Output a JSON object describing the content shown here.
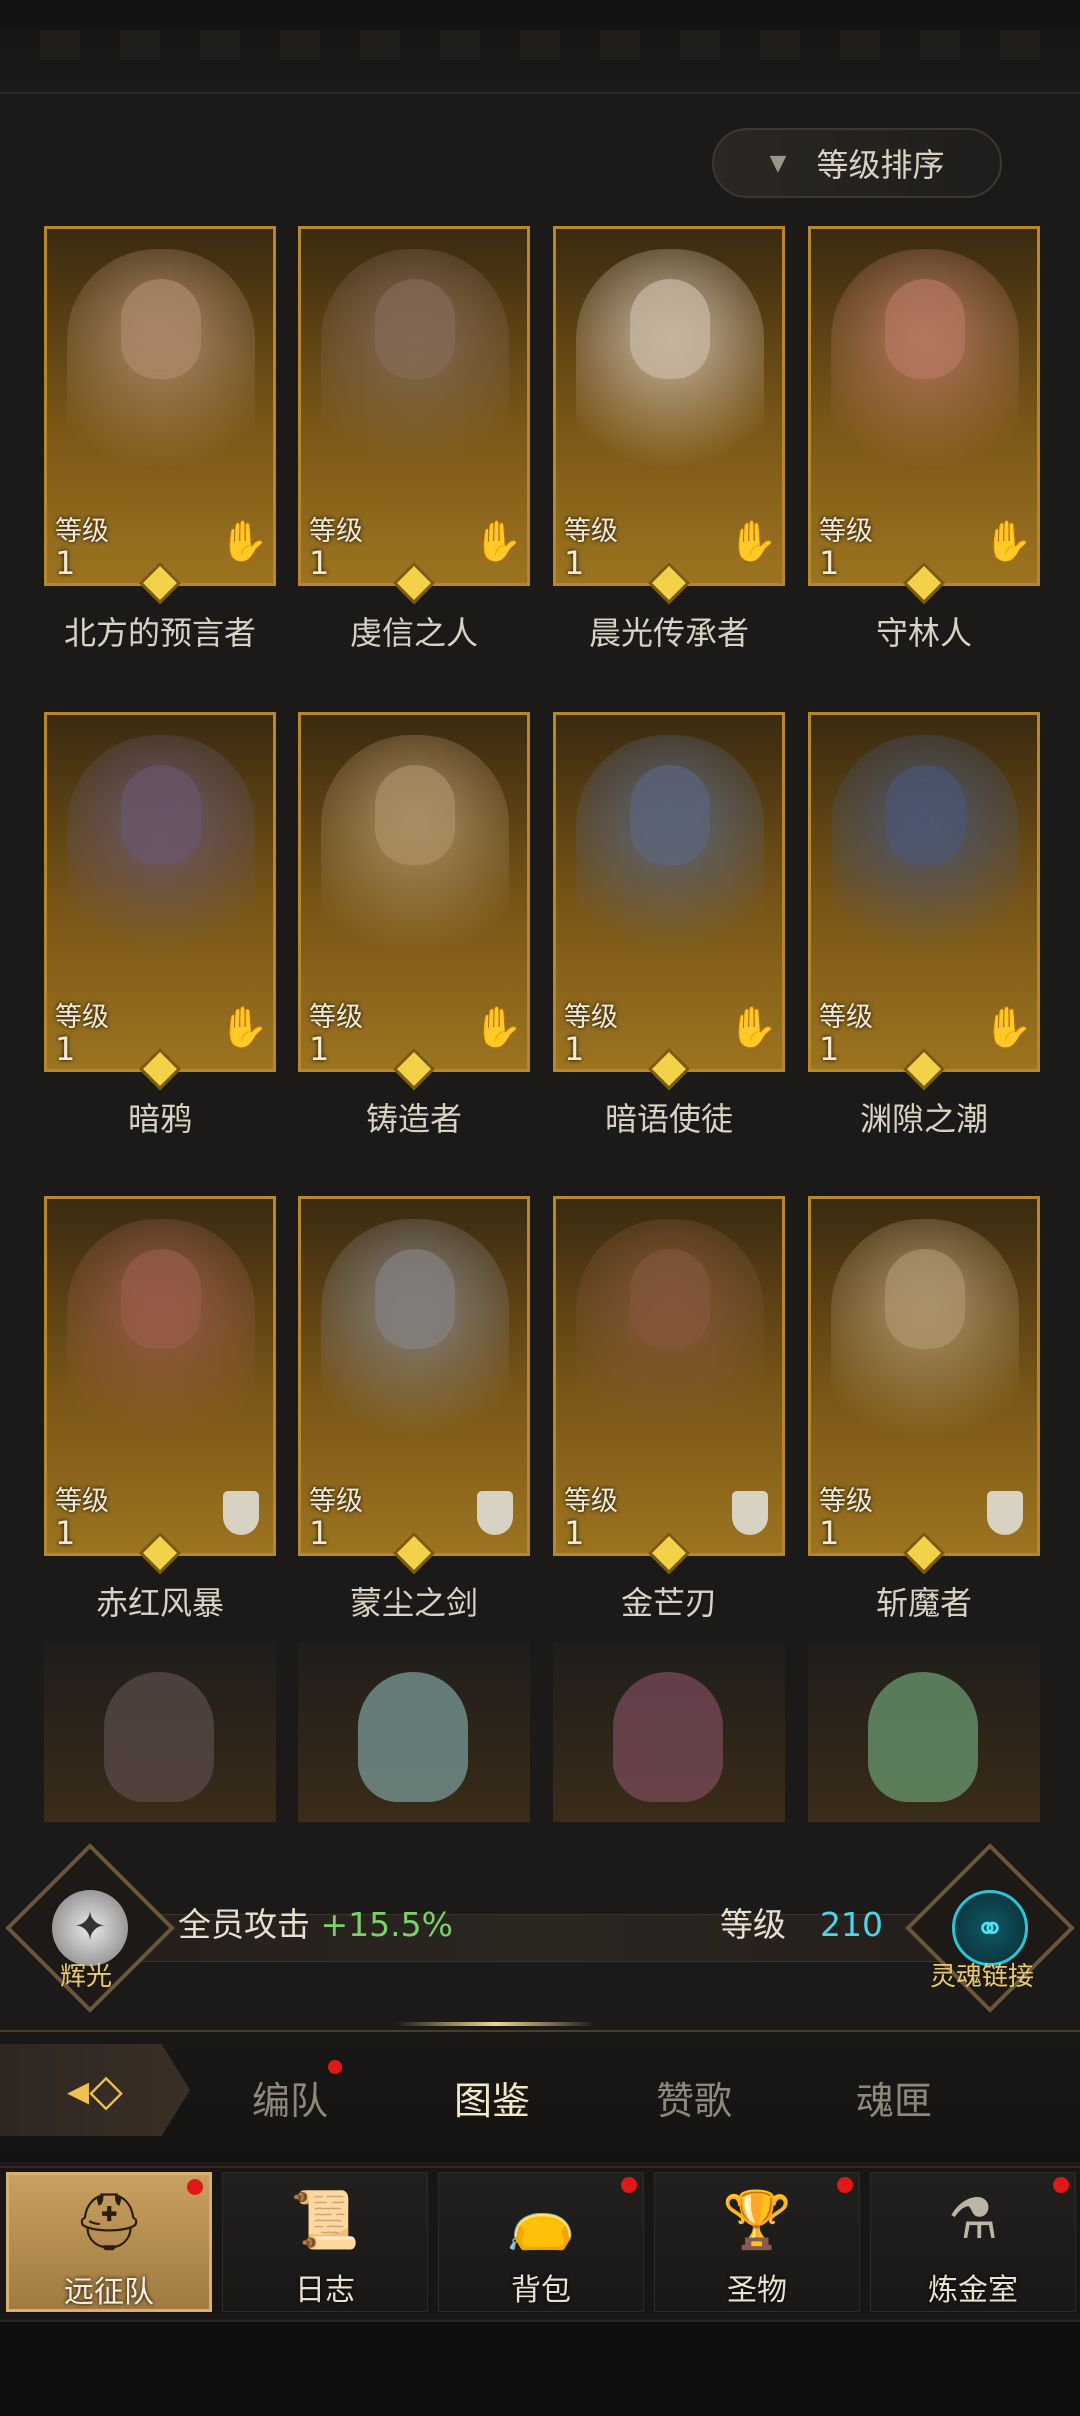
{
  "sort": {
    "label": "等级排序"
  },
  "heroes": [
    {
      "name": "北方的预言者",
      "level_label": "等级",
      "level": "1",
      "class_icon": "palm-icon",
      "skin": "#b89276"
    },
    {
      "name": "虔信之人",
      "level_label": "等级",
      "level": "1",
      "class_icon": "palm-icon",
      "skin": "#8a7060"
    },
    {
      "name": "晨光传承者",
      "level_label": "等级",
      "level": "1",
      "class_icon": "palm-icon",
      "skin": "#d8c8b8"
    },
    {
      "name": "守林人",
      "level_label": "等级",
      "level": "1",
      "class_icon": "palm-icon",
      "skin": "#c0806a"
    },
    {
      "name": "暗鸦",
      "level_label": "等级",
      "level": "1",
      "class_icon": "palm-icon",
      "skin": "#6a5a78"
    },
    {
      "name": "铸造者",
      "level_label": "等级",
      "level": "1",
      "class_icon": "palm-icon",
      "skin": "#b89a70"
    },
    {
      "name": "暗语使徒",
      "level_label": "等级",
      "level": "1",
      "class_icon": "palm-icon",
      "skin": "#5a6a8a"
    },
    {
      "name": "渊隙之潮",
      "level_label": "等级",
      "level": "1",
      "class_icon": "palm-icon",
      "skin": "#4a5a80"
    },
    {
      "name": "赤红风暴",
      "level_label": "等级",
      "level": "1",
      "class_icon": "shield-icon",
      "skin": "#a06050"
    },
    {
      "name": "蒙尘之剑",
      "level_label": "等级",
      "level": "1",
      "class_icon": "shield-icon",
      "skin": "#8a8a90"
    },
    {
      "name": "金芒刃",
      "level_label": "等级",
      "level": "1",
      "class_icon": "shield-icon",
      "skin": "#8a5a40"
    },
    {
      "name": "斩魔者",
      "level_label": "等级",
      "level": "1",
      "class_icon": "shield-icon",
      "skin": "#b8a078"
    }
  ],
  "partial_heroes": [
    {
      "skin": "#5a4a48"
    },
    {
      "skin": "#7a9a98"
    },
    {
      "skin": "#7a4a5a"
    },
    {
      "skin": "#6a9a70"
    }
  ],
  "bonus": {
    "left_emblem_label": "辉光",
    "stat_label": "全员攻击",
    "stat_value": "+15.5%",
    "level_label": "等级",
    "level_value": "210",
    "right_emblem_label": "灵魂链接"
  },
  "subtabs": [
    {
      "label": "编队",
      "badge": true,
      "active": false
    },
    {
      "label": "图鉴",
      "badge": false,
      "active": true
    },
    {
      "label": "赞歌",
      "badge": false,
      "active": false
    },
    {
      "label": "魂匣",
      "badge": false,
      "active": false
    }
  ],
  "bottom_nav": [
    {
      "label": "远征队",
      "icon": "helmet-icon",
      "active": true,
      "badge": true
    },
    {
      "label": "日志",
      "icon": "scroll-icon",
      "active": false,
      "badge": false
    },
    {
      "label": "背包",
      "icon": "bag-icon",
      "active": false,
      "badge": true
    },
    {
      "label": "圣物",
      "icon": "chalice-icon",
      "active": false,
      "badge": true
    },
    {
      "label": "炼金室",
      "icon": "alchemy-icon",
      "active": false,
      "badge": true
    }
  ],
  "colors": {
    "gold_frame": "#b8872c",
    "bonus_green": "#7ad16a",
    "level_cyan": "#4cd4ea",
    "badge_red": "#e01818"
  }
}
